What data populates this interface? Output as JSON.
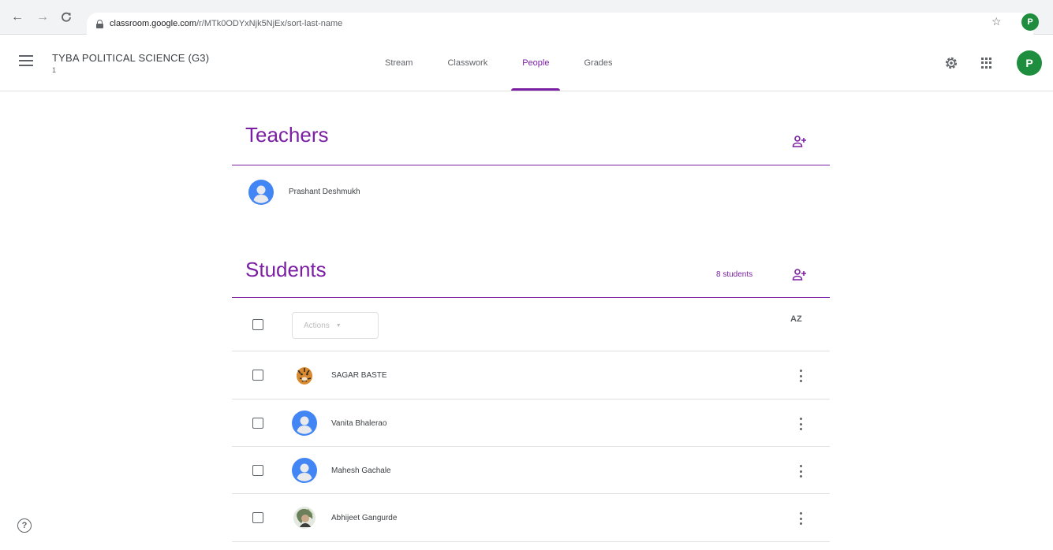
{
  "browser": {
    "url_host": "classroom.google.com",
    "url_path": "/r/MTk0ODYxNjk5NjEx/sort-last-name",
    "avatar_letter": "P"
  },
  "header": {
    "class_title": "TYBA POLITICAL SCIENCE (G3)",
    "class_subtitle": "1",
    "tabs": [
      {
        "label": "Stream",
        "active": false
      },
      {
        "label": "Classwork",
        "active": false
      },
      {
        "label": "People",
        "active": true
      },
      {
        "label": "Grades",
        "active": false
      }
    ],
    "avatar_letter": "P",
    "accent_color": "#7b1fa2"
  },
  "teachers": {
    "title": "Teachers",
    "list": [
      {
        "name": "Prashant Deshmukh",
        "avatar": "default"
      }
    ]
  },
  "students": {
    "title": "Students",
    "count_label": "8 students",
    "actions_label": "Actions",
    "sort_label": "AZ",
    "list": [
      {
        "name": "SAGAR BASTE",
        "avatar": "photo-tiger"
      },
      {
        "name": "Vanita Bhalerao",
        "avatar": "default"
      },
      {
        "name": "Mahesh Gachale",
        "avatar": "default"
      },
      {
        "name": "Abhijeet Gangurde",
        "avatar": "photo-person"
      }
    ]
  },
  "footer": {
    "help_label": "?"
  }
}
